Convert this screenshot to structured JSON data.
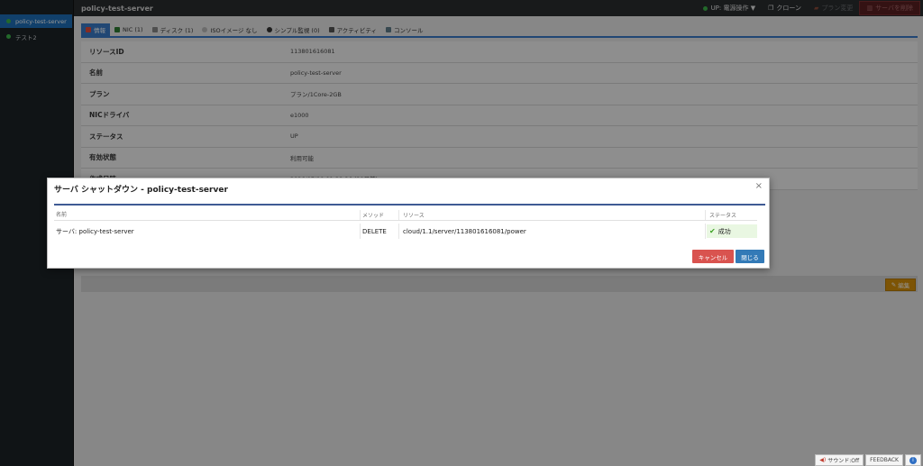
{
  "sidebar": {
    "items": [
      {
        "label": "policy-test-server"
      },
      {
        "label": "テスト2"
      }
    ]
  },
  "topbar": {
    "title": "policy-test-server",
    "power": "UP: 電源操作 ▼",
    "clone": "クローン",
    "plan_change": "プラン変更",
    "delete": "サーバを削除"
  },
  "tabs": [
    {
      "label": "情報"
    },
    {
      "label": "NIC (1)"
    },
    {
      "label": "ディスク (1)"
    },
    {
      "label": "ISOイメージ なし"
    },
    {
      "label": "シンプル監視 (0)"
    },
    {
      "label": "アクティビティ"
    },
    {
      "label": "コンソール"
    }
  ],
  "info": {
    "rows": [
      {
        "key": "リソースID",
        "value": "113801616081"
      },
      {
        "key": "名前",
        "value": "policy-test-server"
      },
      {
        "key": "プラン",
        "value": "プラン/1Core-2GB"
      },
      {
        "key": "NICドライバ",
        "value": "e1000"
      },
      {
        "key": "ステータス",
        "value": "UP"
      },
      {
        "key": "有効状態",
        "value": "利用可能"
      },
      {
        "key": "作成日時",
        "value": "2026/07/19 01:28:26 (29日前)"
      }
    ],
    "edit": "編集"
  },
  "modal": {
    "title": "サーバ シャットダウン - policy-test-server",
    "close_icon": "×",
    "headers": {
      "name": "名前",
      "method": "メソッド",
      "resource": "リソース",
      "status": "ステータス"
    },
    "row": {
      "name": "サーバ: policy-test-server",
      "method": "DELETE",
      "resource": "cloud/1.1/server/113801616081/power",
      "status": "成功"
    },
    "cancel": "キャンセル",
    "close": "閉じる"
  },
  "footer": {
    "sound": "サウンド:Off",
    "feedback": "FEEDBACK",
    "info": "i"
  }
}
